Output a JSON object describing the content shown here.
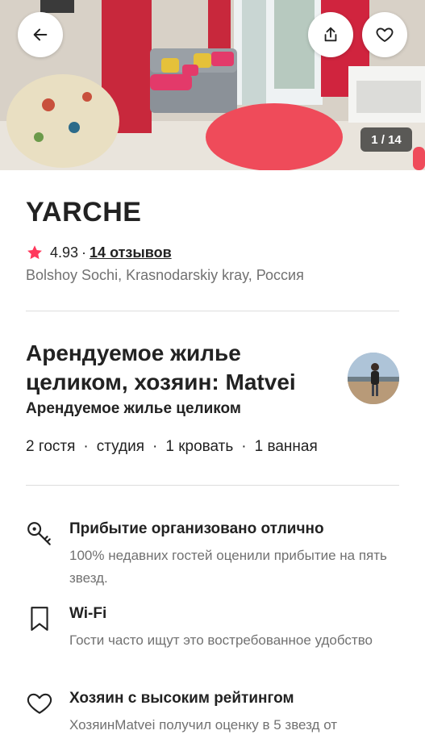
{
  "hero": {
    "photo_counter": "1 / 14",
    "buttons": {
      "back_icon": "arrow-left-icon",
      "share_icon": "share-icon",
      "save_icon": "heart-icon"
    }
  },
  "listing": {
    "title": "YARCHE",
    "rating": "4.93",
    "separator": "·",
    "reviews_link": "14 отзывов",
    "location": "Bolshoy Sochi, Krasnodarskiy kray, Россия"
  },
  "host": {
    "heading": "Арендуемое жилье целиком, хозяин: Matvei",
    "subheading": "Арендуемое жилье целиком"
  },
  "specs": [
    "2 гостя",
    "студия",
    "1 кровать",
    "1 ванная"
  ],
  "specs_separator": "·",
  "features": [
    {
      "icon": "key-icon",
      "title": "Прибытие организовано отлично",
      "description": "100% недавних гостей оценили прибытие на пять звезд."
    },
    {
      "icon": "bookmark-icon",
      "title": "Wi-Fi",
      "description": "Гости часто ищут это востребованное удобство"
    },
    {
      "icon": "heart-icon",
      "title": "Хозяин с высоким рейтингом",
      "description": "ХозяинMatvei получил оценку в 5 звезд от"
    }
  ],
  "colors": {
    "accent": "#FF385C",
    "text_primary": "#222222",
    "text_secondary": "#717171",
    "divider": "#DDDDDD"
  }
}
